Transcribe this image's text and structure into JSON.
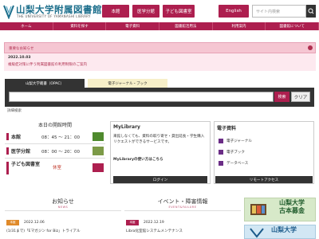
{
  "header": {
    "logo_title": "山梨大学附属図書館",
    "logo_sub": "THE UNIVERSITY OF YAMANASHI LIBRARY",
    "btn_main": "本館",
    "btn_medical": "医学分館",
    "btn_kids": "子ども図書室",
    "btn_english": "English",
    "search_placeholder": "サイト内検索"
  },
  "nav": [
    "ホーム",
    "資料を探す",
    "電子資料",
    "図書館活用法",
    "利用案内",
    "図書館について"
  ],
  "colors": {
    "accent": "#ad1f4f",
    "brand": "#1d6f8c",
    "dark": "#333333",
    "green": "#4f8a2e"
  },
  "notice": {
    "heading": "重要なお知らせ",
    "date": "2022.10.03",
    "text": "複級症対策に伴う附属図書館の利用制限のご案内"
  },
  "opac": {
    "tab_opac": "山梨大学蔵書（OPAC）",
    "tab_ej": "電子ジャーナル・ブック",
    "search_label": "検索",
    "clear_label": "クリア",
    "advanced_label": "詳細検索"
  },
  "hours": {
    "title": "本日の開館時間",
    "rows": [
      {
        "name": "本館",
        "time": "08：45 〜 21：00"
      },
      {
        "name": "医学分館",
        "time": "08：00 〜 20：00"
      },
      {
        "name": "子ども図書室",
        "time": "休室"
      }
    ]
  },
  "mylibrary": {
    "title": "MyLibrary",
    "text": "来館しなくても、資料の取り寄せ・貸出延長・学生購入リクエストができるサービスです。",
    "usage": "MyLibraryの使い方はこちら",
    "login": "ログイン"
  },
  "eresources": {
    "title": "電子資料",
    "items": [
      "電子ジャーナル",
      "電子ブック",
      "データベース"
    ],
    "remote": "リモートアクセス"
  },
  "news": {
    "title": "お知らせ",
    "sub": "NEWS",
    "date": "2022.12.06",
    "tag": "本館",
    "item": "(1/31まで)「Eマガジン for Biz」トライアル"
  },
  "events": {
    "title": "イベント・障害情報",
    "sub": "EVENT&FAILURE",
    "date": "2022.12.19",
    "tag": "本館",
    "item": "Libra化室館システムメンテナンス"
  },
  "banners": {
    "fund": "山梨大学\n古本募金",
    "repo": "山梨大学"
  }
}
